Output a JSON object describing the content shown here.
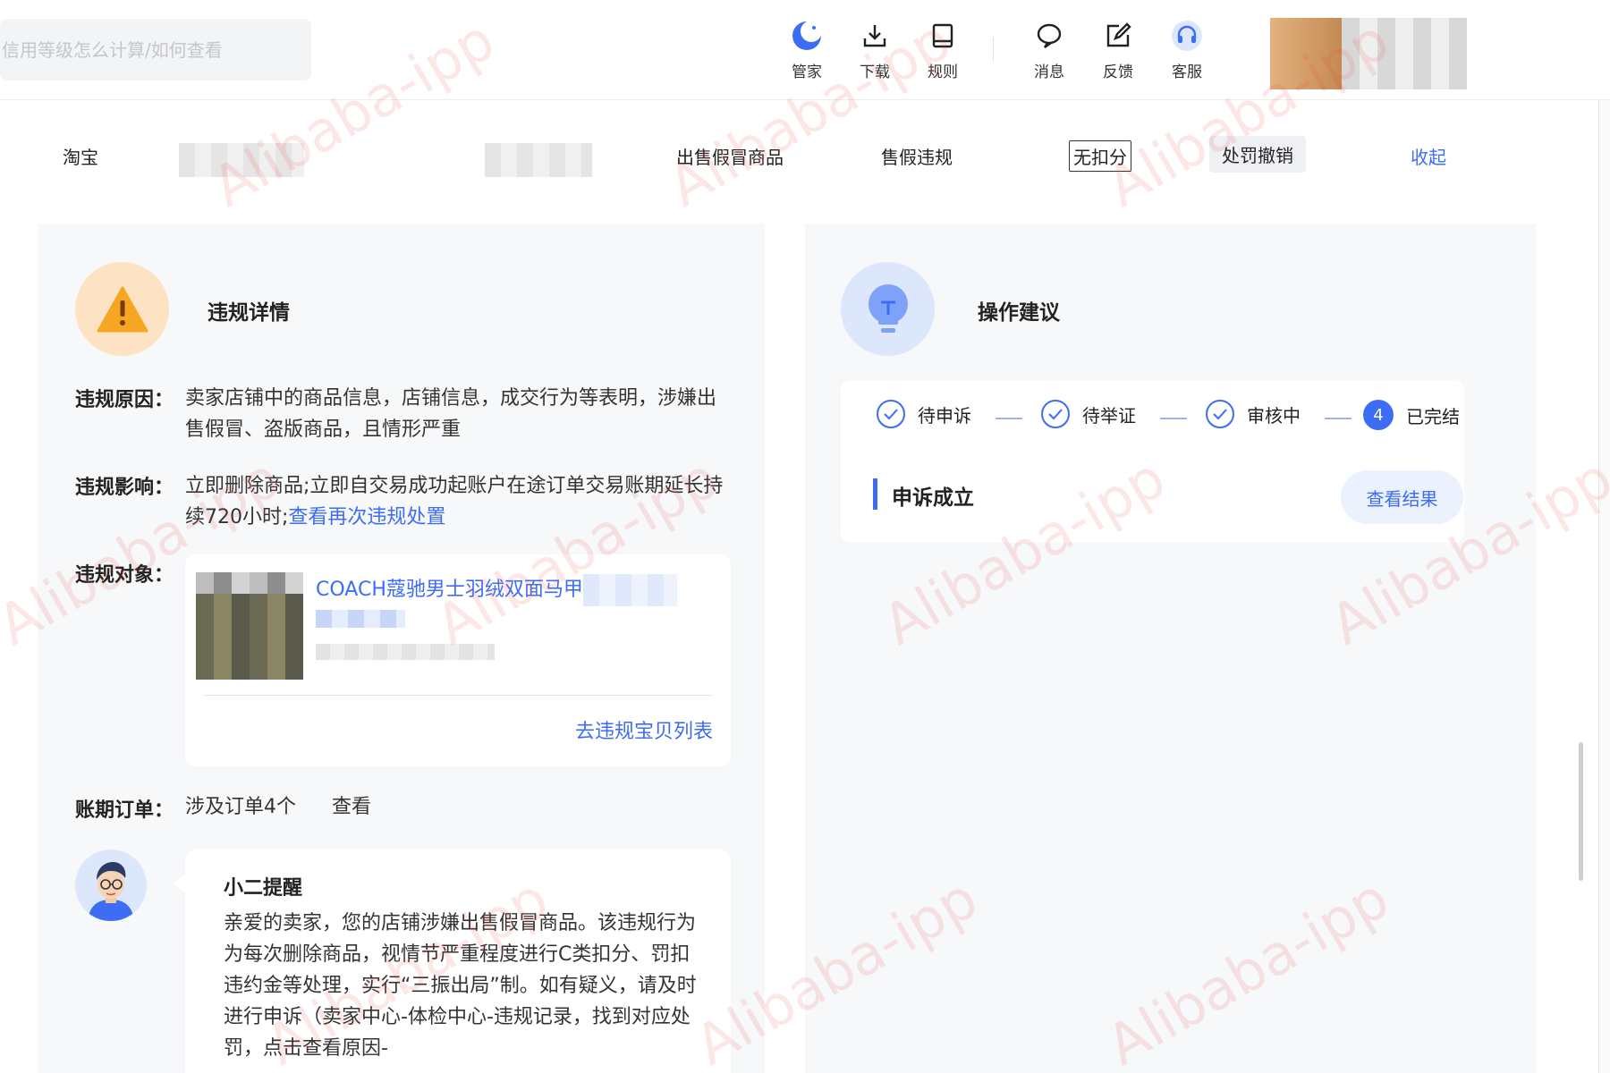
{
  "search": {
    "placeholder": "信用等级怎么计算/如何查看"
  },
  "toolbar": {
    "items": [
      {
        "label": "管家",
        "icon": "butler-moon-icon"
      },
      {
        "label": "下载",
        "icon": "download-icon"
      },
      {
        "label": "规则",
        "icon": "rules-book-icon"
      },
      {
        "label": "消息",
        "icon": "message-bubble-icon"
      },
      {
        "label": "反馈",
        "icon": "feedback-edit-icon"
      },
      {
        "label": "客服",
        "icon": "headset-icon"
      }
    ]
  },
  "filter_row": {
    "platform": "淘宝",
    "violation_type": "出售假冒商品",
    "category": "售假违规",
    "score_tag": "无扣分",
    "status": "处罚撤销",
    "collapse": "收起"
  },
  "violation": {
    "title": "违规详情",
    "reason_label": "违规原因：",
    "reason_text": "卖家店铺中的商品信息，店铺信息，成交行为等表明，涉嫌出售假冒、盗版商品，且情形严重",
    "impact_label": "违规影响：",
    "impact_text": "立即删除商品;立即自交易成功起账户在途订单交易账期延长持续720小时;",
    "impact_link": "查看再次违规处置",
    "object_label": "违规对象：",
    "object_title": "COACH蔻驰男士羽绒双面马甲",
    "object_link": "去违规宝贝列表",
    "orders_label": "账期订单：",
    "orders_text": "涉及订单4个",
    "orders_link": "查看"
  },
  "reminder": {
    "title": "小二提醒",
    "body": "亲爱的卖家，您的店铺涉嫌出售假冒商品。该违规行为为每次删除商品，视情节严重程度进行C类扣分、罚扣违约金等处理，实行“三振出局”制。如有疑义，请及时进行申诉（卖家中心-体检中心-违规记录，找到对应处罚，点击查看原因-"
  },
  "suggestion": {
    "title": "操作建议",
    "steps": [
      {
        "label": "待申诉",
        "state": "done"
      },
      {
        "label": "待举证",
        "state": "done"
      },
      {
        "label": "审核中",
        "state": "done"
      },
      {
        "label": "已完结",
        "state": "current",
        "number": "4"
      }
    ],
    "appeal_status": "申诉成立",
    "result_button": "查看结果"
  },
  "watermark": "Alibaba-ipp",
  "colors": {
    "accent": "#3d6df5",
    "warning": "#f5a623",
    "warning_bg": "#fde2c4",
    "bulb_bg": "#dde7fb"
  }
}
